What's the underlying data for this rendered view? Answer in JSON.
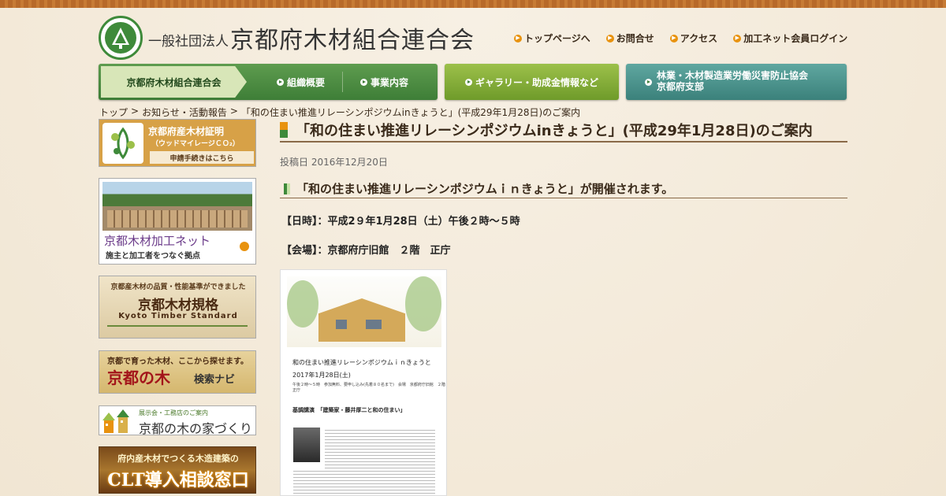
{
  "header": {
    "org_prefix": "一般社団法人",
    "org_name": "京都府木材組合連合会",
    "util_links": [
      "トップページへ",
      "お問合せ",
      "アクセス",
      "加工ネット会員ログイン"
    ]
  },
  "main_nav": {
    "home": "京都府木材組合連合会",
    "items": [
      "組織概要",
      "事業内容"
    ],
    "gallery": "ギャラリー・助成金情報など",
    "safety_line1": "林業・木材製造業労働災害防止協会",
    "safety_line2": "京都府支部"
  },
  "breadcrumb": {
    "items": [
      "トップ",
      "お知らせ・活動報告",
      "「和の住まい推進リレーシンポジウムinきょうと」(平成29年1月28日)のご案内"
    ],
    "separator": ">"
  },
  "sidebar": {
    "b1_title": "京都府産木材証明",
    "b1_sub": "（ウッドマイレージＣＯ₂）",
    "b1_link": "申請手続きはこちら",
    "b2_title": "京都木材加工ネット",
    "b2_sub": "施主と加工者をつなぐ拠点",
    "b3_top": "京都産木材の品質・性能基準ができました",
    "b3_title": "京都木材規格",
    "b3_en": "Kyoto Timber Standard",
    "b4_top": "京都で育った木材、ここから探せます。",
    "b4_title": "京都の木",
    "b4_sub": "検索ナビ",
    "b5_top": "展示会・工務店のご案内",
    "b5_title": "京都の木の家づくり",
    "b6_top": "府内産木材でつくる木造建築の",
    "b6_title": "CLT導入相談窓口"
  },
  "article": {
    "title": "「和の住まい推進リレーシンポジウムinきょうと」(平成29年1月28日)のご案内",
    "posted": "投稿日 2016年12月20日",
    "subtitle": "「和の住まい推進リレーシンポジウムｉｎきょうと」が開催されます。",
    "datetime": "【日時】：平成2９年1月28日（土）午後２時～５時",
    "venue": "【会場】：京都府庁旧館　２階　正庁"
  },
  "flyer": {
    "heading": "和の住まい推進リレーシンポジウムｉｎきょうと",
    "date": "2017年1月28日(土)",
    "details": "午後２時～５時　参加無料、要申し込み(先着８０名まで)　会場　京都府庁旧館　２階　正庁",
    "lecture": "基調講演　「建築家・藤井厚二と和の住まい」"
  },
  "colors": {
    "accent_orange": "#e8920e",
    "nav_green": "#3e7e37",
    "nav_lime": "#7ea436",
    "nav_teal": "#3b817b",
    "title_brown": "#3a2a1a"
  }
}
